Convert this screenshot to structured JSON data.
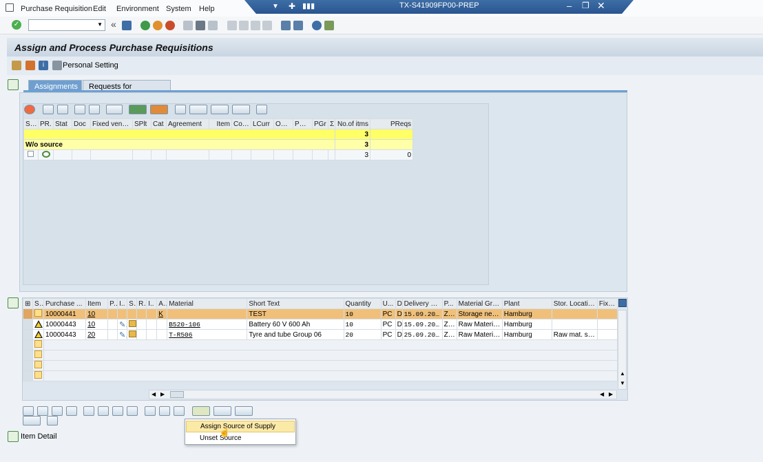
{
  "menu": [
    "Purchase Requisition",
    "Edit",
    "Environment",
    "System",
    "Help"
  ],
  "window_title": "TX-S41909FP00-PREP",
  "page_title": "Assign and Process Purchase Requisitions",
  "app_toolbar": {
    "personal_setting": "Personal Setting"
  },
  "tabs": [
    "Assignments",
    "Requests for Quotations"
  ],
  "upper_grid": {
    "headers": [
      "Sel.",
      "PR.",
      "Stat",
      "Doc",
      "Fixed vendor",
      "SPlt",
      "Cat",
      "Agreement",
      "Item",
      "CoCd",
      "LCurr",
      "OTyp",
      "POrg",
      "PGr",
      "Σ",
      "No.of itms",
      "PReqs"
    ],
    "total_row": {
      "items": "3"
    },
    "subtotal_row": {
      "label": "W/o source",
      "items": "3"
    },
    "data_row": {
      "items": "3",
      "preqs": "0"
    }
  },
  "lower_grid": {
    "headers": [
      "S..",
      "Purchase ...",
      "Item",
      "P..",
      "I..",
      "S..",
      "R..",
      "I..",
      "A..",
      "Material",
      "Short Text",
      "Quantity",
      "U...",
      "D",
      "Delivery D...",
      "P...",
      "Material Gro...",
      "Plant",
      "Stor. Location",
      "Fixed"
    ],
    "rows": [
      {
        "pr": "10000441",
        "item": "10",
        "acct": "K",
        "material": "",
        "short_text": "TEST",
        "qty": "10",
        "unit": "PC",
        "d": "D",
        "delivery": "15.09.2020",
        "pgr": "Z06",
        "matgrp": "Storage need...",
        "plant": "Hamburg",
        "sloc": ""
      },
      {
        "pr": "10000443",
        "item": "10",
        "acct": "",
        "material": "B520-106",
        "short_text": "Battery 60 V 600 Ah",
        "qty": "10",
        "unit": "PC",
        "d": "D",
        "delivery": "15.09.2020",
        "pgr": "Z06",
        "matgrp": "Raw Materials",
        "plant": "Hamburg",
        "sloc": ""
      },
      {
        "pr": "10000443",
        "item": "20",
        "acct": "",
        "material": "T-R506",
        "short_text": "Tyre and tube Group 06",
        "qty": "20",
        "unit": "PC",
        "d": "D",
        "delivery": "25.09.2020",
        "pgr": "Z06",
        "matgrp": "Raw Materials",
        "plant": "Hamburg",
        "sloc": "Raw mat. stol."
      }
    ]
  },
  "item_detail": "Item Detail",
  "context_menu": [
    "Assign Source of Supply",
    "Unset Source"
  ],
  "colors": {
    "selected_row": "#f0c07a",
    "yellow_total": "#ffff66",
    "tab_active": "#6f9fd0"
  }
}
